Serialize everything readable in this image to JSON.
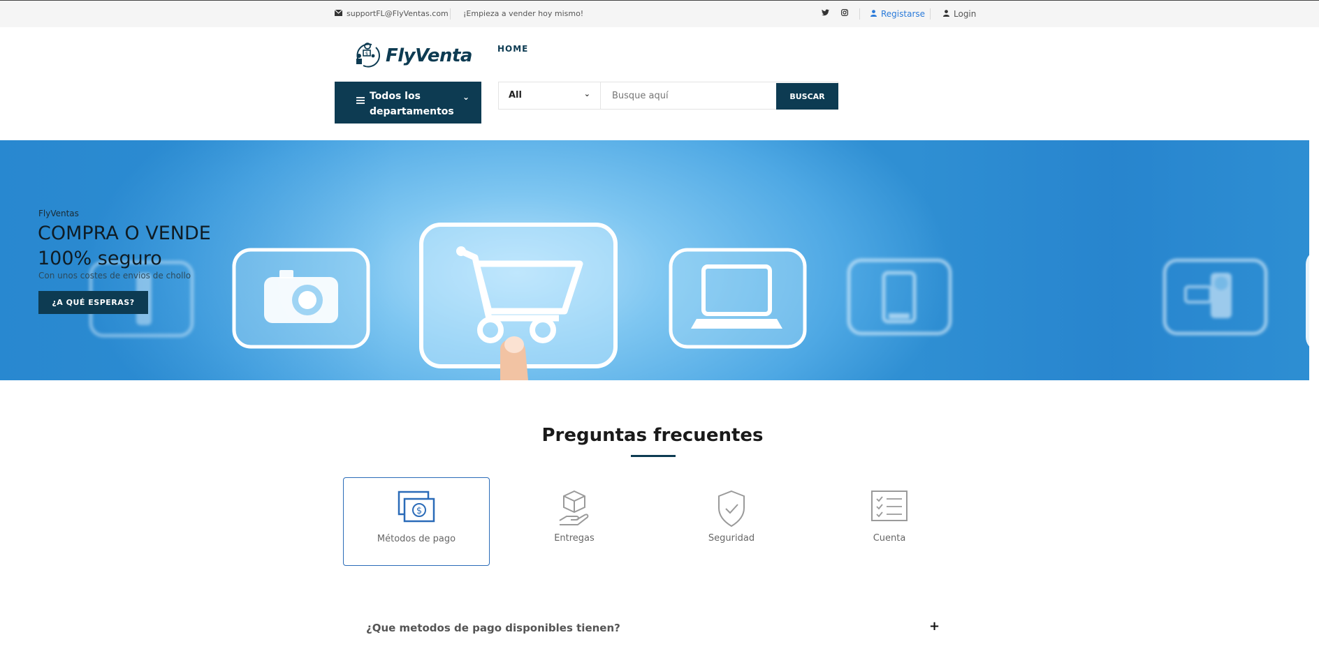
{
  "topbar": {
    "email": "supportFL@FlyVentas.com",
    "tagline": "¡Empieza a vender hoy mismo!",
    "register_label": "Registarse",
    "login_label": "Login"
  },
  "header": {
    "logo_text": "FlyVenta",
    "nav_home": "HOME",
    "departments_label": "Todos los departamentos",
    "search_category": "All",
    "search_placeholder": "Busque aquí",
    "search_button": "BUSCAR"
  },
  "hero": {
    "kicker": "FlyVentas",
    "title_line1": "COMPRA O VENDE",
    "title_line2": "100% seguro",
    "subtitle": "Con unos costes de envios de chollo",
    "cta_label": "¿A QUÉ ESPERAS?"
  },
  "faq": {
    "title": "Preguntas frecuentes",
    "tabs": [
      {
        "label": "Métodos de pago",
        "icon": "money-icon",
        "active": true
      },
      {
        "label": "Entregas",
        "icon": "package-hand-icon",
        "active": false
      },
      {
        "label": "Seguridad",
        "icon": "shield-check-icon",
        "active": false
      },
      {
        "label": "Cuenta",
        "icon": "checklist-icon",
        "active": false
      }
    ],
    "question": "¿Que metodos de pago disponibles tienen?",
    "toggle": "+"
  },
  "colors": {
    "brand_dark": "#0d3b52",
    "link_blue": "#2a7ad9",
    "active_border": "#2a6bb8"
  }
}
